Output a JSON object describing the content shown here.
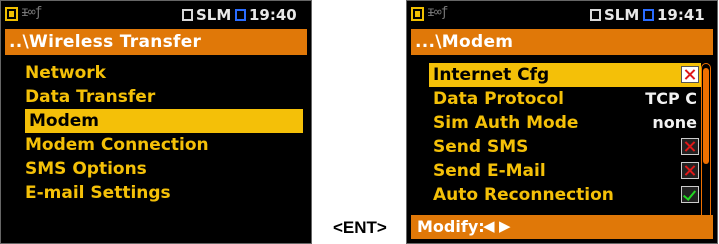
{
  "left_screen": {
    "status": {
      "mode": "SLM",
      "time": "19:40",
      "indicators": "ᵻ∞ƒ"
    },
    "title": "..\\Wireless Transfer",
    "items": [
      {
        "label": "Network"
      },
      {
        "label": "Data Transfer"
      },
      {
        "label": "Modem"
      },
      {
        "label": "Modem Connection"
      },
      {
        "label": "SMS Options"
      },
      {
        "label": "E-mail Settings"
      }
    ],
    "selected_index": 2
  },
  "transition_label": "<ENT>",
  "right_screen": {
    "status": {
      "mode": "SLM",
      "time": "19:41",
      "indicators": "ᵻ∞ƒ"
    },
    "title": "...\\Modem",
    "rows": [
      {
        "label": "Internet Cfg",
        "control": "checkbox",
        "checked": false
      },
      {
        "label": "Data Protocol",
        "control": "value",
        "value": "TCP C"
      },
      {
        "label": "Sim Auth Mode",
        "control": "value",
        "value": "none"
      },
      {
        "label": "Send SMS",
        "control": "checkbox",
        "checked": false
      },
      {
        "label": "Send E-Mail",
        "control": "checkbox",
        "checked": false
      },
      {
        "label": "Auto Reconnection",
        "control": "checkbox",
        "checked": true
      }
    ],
    "selected_index": 0,
    "footer": {
      "text": "Modify:",
      "left_arrow": "◀",
      "right_arrow": "▶"
    }
  },
  "colors": {
    "accent": "#f4c008",
    "title_bar": "#e07808",
    "background": "#000000",
    "checked": "#22d822",
    "unchecked": "#e01818",
    "sd_indicator": "#2a6cff"
  }
}
